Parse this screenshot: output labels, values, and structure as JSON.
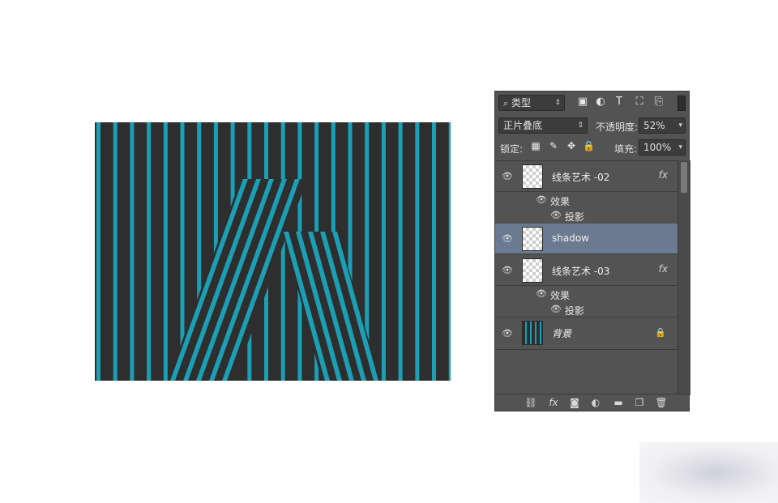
{
  "artwork": {
    "background_color": "#2e2e2e",
    "stripe_color": "#1a9fb5",
    "description_icon": "letter-a-line-art"
  },
  "panel": {
    "filter": {
      "selected": "类型",
      "icons": [
        "image-filter-icon",
        "adjustment-filter-icon",
        "type-filter-icon",
        "shape-filter-icon",
        "smart-object-filter-icon"
      ]
    },
    "blend_mode": "正片叠底",
    "opacity_label": "不透明度:",
    "opacity_value": "52%",
    "lock_label": "锁定:",
    "fill_label": "填充:",
    "fill_value": "100%",
    "layers": [
      {
        "name": "线条艺术 -02",
        "has_fx": true,
        "fx_label": "fx",
        "effects_label": "效果",
        "effect_item": "投影"
      },
      {
        "name": "shadow",
        "selected": true
      },
      {
        "name": "线条艺术 -03",
        "has_fx": true,
        "fx_label": "fx",
        "effects_label": "效果",
        "effect_item": "投影"
      },
      {
        "name": "背景",
        "locked": true
      }
    ],
    "footer_icons": [
      "link-icon",
      "fx-icon",
      "mask-icon",
      "adjustment-icon",
      "folder-icon",
      "new-layer-icon",
      "trash-icon"
    ]
  }
}
